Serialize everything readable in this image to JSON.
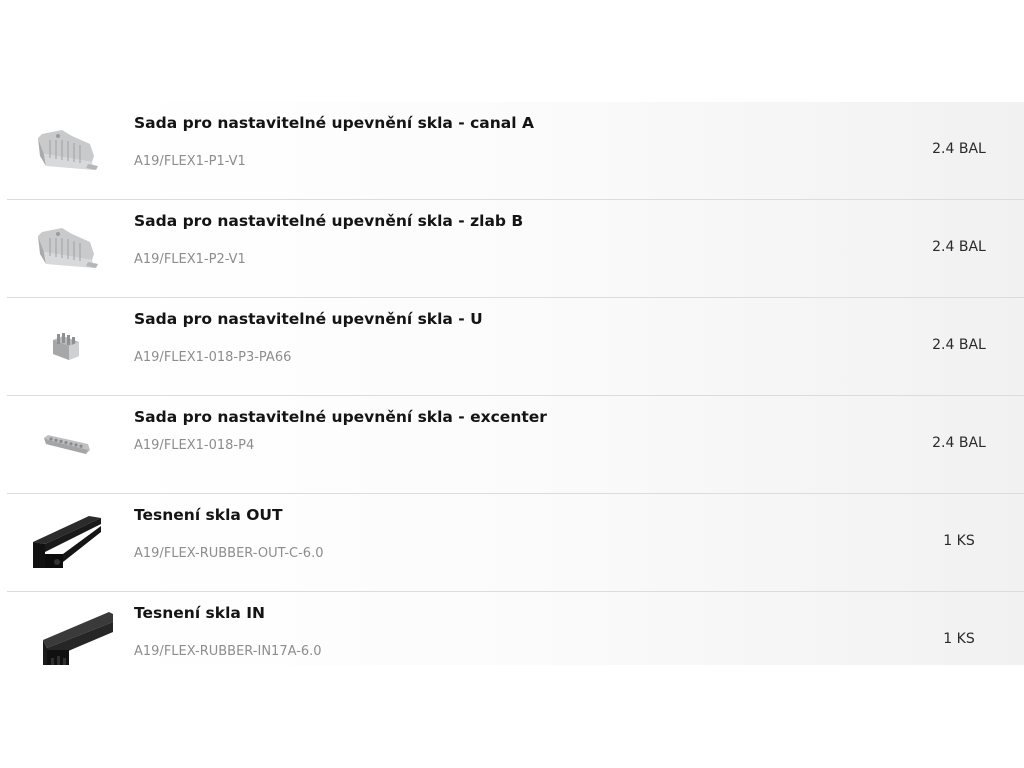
{
  "items": [
    {
      "title": "Sada pro nastavitelné upevnění skla - canal A",
      "code": "A19/FLEX1-P1-V1",
      "qty": "2.4 BAL",
      "icon": "clip-bracket-icon"
    },
    {
      "title": "Sada pro nastavitelné upevnění skla - zlab B",
      "code": "A19/FLEX1-P2-V1",
      "qty": "2.4 BAL",
      "icon": "clip-bracket-icon"
    },
    {
      "title": "Sada pro nastavitelné upevnění skla - U",
      "code": "A19/FLEX1-018-P3-PA66",
      "qty": "2.4 BAL",
      "icon": "u-clip-icon"
    },
    {
      "title": "Sada pro nastavitelné upevnění skla - excenter",
      "code": "A19/FLEX1-018-P4",
      "qty": "2.4 BAL",
      "icon": "excenter-strip-icon"
    },
    {
      "title": "Tesnení skla OUT",
      "code": "A19/FLEX-RUBBER-OUT-C-6.0",
      "qty": "1 KS",
      "icon": "rubber-seal-out-icon"
    },
    {
      "title": "Tesnení skla IN",
      "code": "A19/FLEX-RUBBER-IN17A-6.0",
      "qty": "1 KS",
      "icon": "rubber-seal-in-icon"
    }
  ]
}
